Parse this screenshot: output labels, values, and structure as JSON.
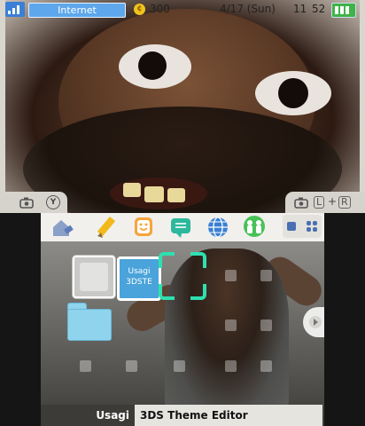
{
  "status_bar": {
    "connection": "Internet",
    "coins": "300",
    "date": "4/17 (Sun)",
    "clock_hour": "11",
    "clock_minute": "52",
    "icons": [
      "signal-icon",
      "coin-icon",
      "battery-icon"
    ]
  },
  "top_screen_tabs": {
    "left_glyph": "Y",
    "right_glyph_l": "L",
    "right_glyph_plus": "+",
    "right_glyph_r": "R",
    "icons": [
      "camera-icon",
      "y-button-icon",
      "camera-icon",
      "l-button-icon",
      "r-button-icon"
    ]
  },
  "home_menu": {
    "top_icons": [
      {
        "name": "settings-icon"
      },
      {
        "name": "pencil-icon"
      },
      {
        "name": "smiley-icon"
      },
      {
        "name": "notes-icon"
      },
      {
        "name": "globe-icon"
      },
      {
        "name": "friends-icon"
      }
    ],
    "view_toggle_icons": [
      "large-icons-view-icon",
      "grid-view-icon"
    ],
    "apps": [
      {
        "name": "empty-slot"
      },
      {
        "name": "usagi-app",
        "label": "Usagi 3DSTE"
      },
      {
        "name": "folder"
      }
    ],
    "selected_app_title_left": "Usagi",
    "selected_app_title_right": "3DS Theme Editor"
  },
  "colors": {
    "accent_cursor": "#2ee0b0",
    "internet_pill": "#5ea7ec",
    "battery": "#3fb347",
    "app_blue": "#4aa3da"
  }
}
